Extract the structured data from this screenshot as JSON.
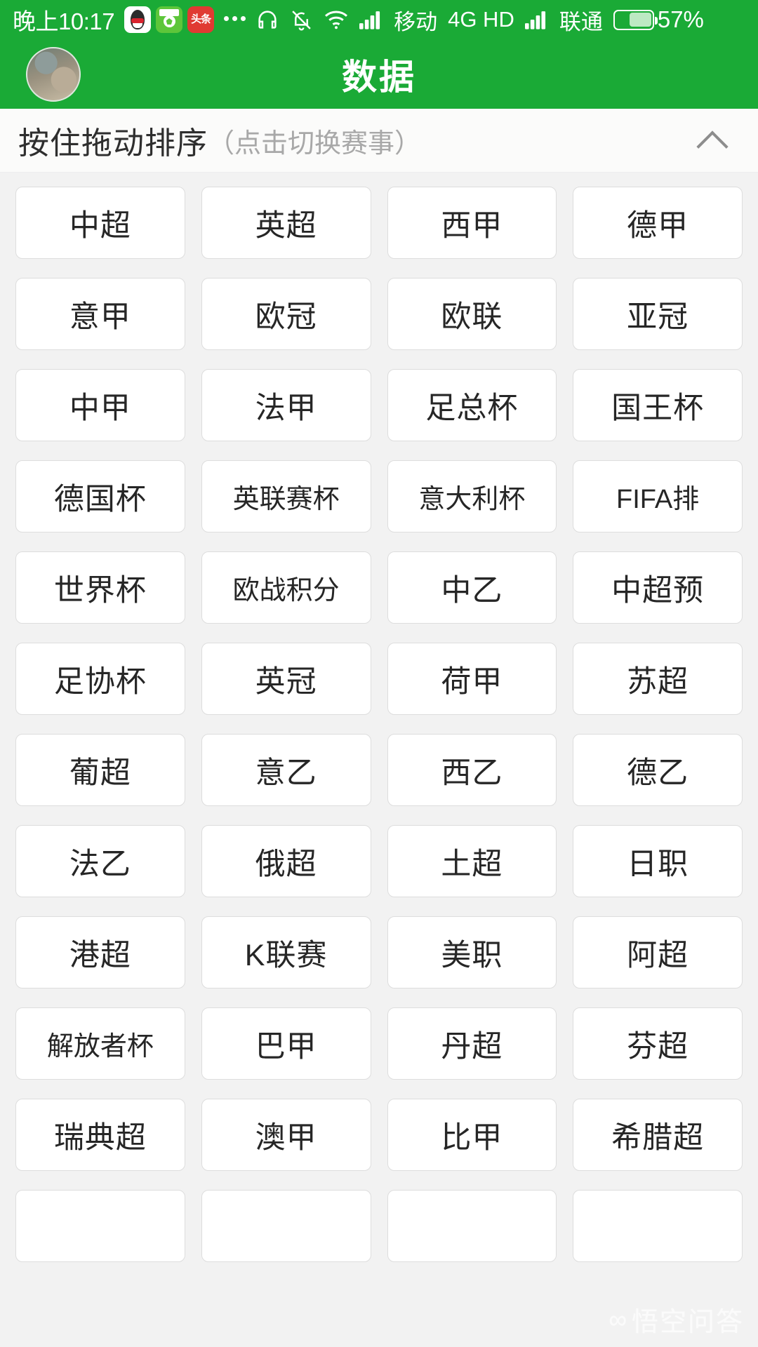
{
  "status_bar": {
    "time": "晚上10:17",
    "app_icons": [
      "qq-icon",
      "football-app-icon",
      "toutiao-icon"
    ],
    "overflow_dots": "...",
    "icons": [
      "headphone-icon",
      "bell-muted-icon",
      "wifi-icon",
      "signal-icon-1",
      "signal-icon-2"
    ],
    "carrier_primary": "移动",
    "network_type": "4G HD",
    "carrier_secondary": "联通",
    "battery_percent": "57%",
    "background_color": "#1aaa36"
  },
  "header": {
    "title": "数据",
    "avatar": "user-avatar",
    "background_color": "#1aaa36"
  },
  "sort_bar": {
    "main_text": "按住拖动排序",
    "sub_text": "（点击切换赛事）",
    "collapse_icon": "chevron-up-icon"
  },
  "grid": {
    "columns": 4,
    "items": [
      "中超",
      "英超",
      "西甲",
      "德甲",
      "意甲",
      "欧冠",
      "欧联",
      "亚冠",
      "中甲",
      "法甲",
      "足总杯",
      "国王杯",
      "德国杯",
      "英联赛杯",
      "意大利杯",
      "FIFA排",
      "世界杯",
      "欧战积分",
      "中乙",
      "中超预",
      "足协杯",
      "英冠",
      "荷甲",
      "苏超",
      "葡超",
      "意乙",
      "西乙",
      "德乙",
      "法乙",
      "俄超",
      "土超",
      "日职",
      "港超",
      "K联赛",
      "美职",
      "阿超",
      "解放者杯",
      "巴甲",
      "丹超",
      "芬超",
      "瑞典超",
      "澳甲",
      "比甲",
      "希腊超",
      "",
      "",
      "",
      ""
    ]
  },
  "watermark": {
    "mark": "∞",
    "text": "悟空问答"
  }
}
